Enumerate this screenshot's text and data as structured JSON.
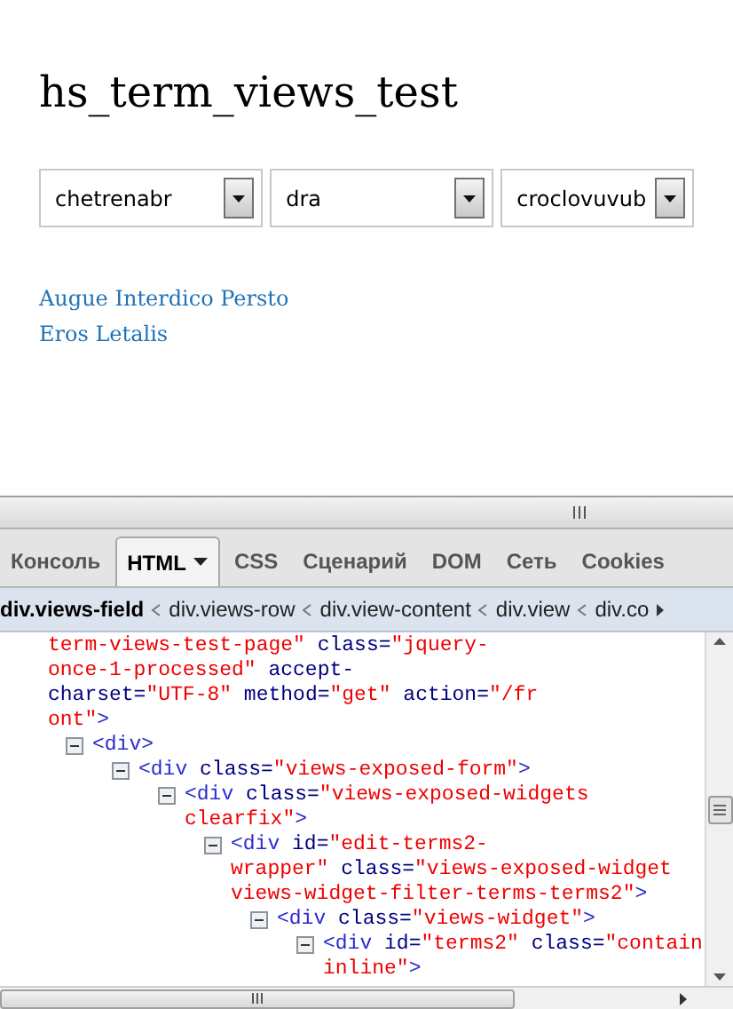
{
  "page": {
    "title": "hs_term_views_test"
  },
  "filters": [
    {
      "value": "chetrenabr"
    },
    {
      "value": "dra"
    },
    {
      "value": "croclovuvub"
    }
  ],
  "links": [
    "Augue Interdico Persto",
    "Eros Letalis"
  ],
  "devtools": {
    "tabs": [
      {
        "label": "Консоль",
        "selected": false,
        "menu": false
      },
      {
        "label": "HTML",
        "selected": true,
        "menu": true
      },
      {
        "label": "CSS",
        "selected": false,
        "menu": false
      },
      {
        "label": "Сценарий",
        "selected": false,
        "menu": false
      },
      {
        "label": "DOM",
        "selected": false,
        "menu": false
      },
      {
        "label": "Сеть",
        "selected": false,
        "menu": false
      },
      {
        "label": "Cookies",
        "selected": false,
        "menu": false
      }
    ],
    "breadcrumb": [
      {
        "label": "div.views-field",
        "selected": true
      },
      {
        "label": "div.views-row",
        "selected": false
      },
      {
        "label": "div.view-content",
        "selected": false
      },
      {
        "label": "div.view",
        "selected": false
      },
      {
        "label": "div.co",
        "selected": false
      }
    ],
    "nodes": [
      {
        "lines": [
          [
            {
              "kind": "value",
              "text": "term-views-test-page\""
            },
            {
              "kind": "attr",
              "text": " class="
            },
            {
              "kind": "value",
              "text": "\"jquery-"
            }
          ],
          [
            {
              "kind": "value",
              "text": "once-1-processed\""
            },
            {
              "kind": "attr",
              "text": " accept-"
            }
          ],
          [
            {
              "kind": "attr",
              "text": "charset="
            },
            {
              "kind": "value",
              "text": "\"UTF-8\""
            },
            {
              "kind": "attr",
              "text": " method="
            },
            {
              "kind": "value",
              "text": "\"get\""
            },
            {
              "kind": "attr",
              "text": " action="
            },
            {
              "kind": "value",
              "text": "\"/fr"
            }
          ],
          [
            {
              "kind": "value",
              "text": "ont\""
            },
            {
              "kind": "tag",
              "text": ">"
            }
          ]
        ],
        "children": [
          {
            "expanded": true,
            "lines": [
              [
                {
                  "kind": "tag",
                  "text": "<div>"
                }
              ]
            ],
            "children": [
              {
                "expanded": true,
                "lines": [
                  [
                    {
                      "kind": "tag",
                      "text": "<div"
                    },
                    {
                      "kind": "attr",
                      "text": " class="
                    },
                    {
                      "kind": "value",
                      "text": "\"views-exposed-form\""
                    },
                    {
                      "kind": "tag",
                      "text": ">"
                    }
                  ]
                ],
                "children": [
                  {
                    "expanded": true,
                    "lines": [
                      [
                        {
                          "kind": "tag",
                          "text": "<div"
                        },
                        {
                          "kind": "attr",
                          "text": " class="
                        },
                        {
                          "kind": "value",
                          "text": "\"views-exposed-widgets"
                        }
                      ],
                      [
                        {
                          "kind": "value",
                          "text": "clearfix\""
                        },
                        {
                          "kind": "tag",
                          "text": ">"
                        }
                      ]
                    ],
                    "children": [
                      {
                        "expanded": true,
                        "lines": [
                          [
                            {
                              "kind": "tag",
                              "text": "<div"
                            },
                            {
                              "kind": "attr",
                              "text": " id="
                            },
                            {
                              "kind": "value",
                              "text": "\"edit-terms2-"
                            }
                          ],
                          [
                            {
                              "kind": "value",
                              "text": "wrapper\""
                            },
                            {
                              "kind": "attr",
                              "text": " class="
                            },
                            {
                              "kind": "value",
                              "text": "\"views-exposed-widget"
                            }
                          ],
                          [
                            {
                              "kind": "value",
                              "text": "views-widget-filter-terms-terms2\""
                            },
                            {
                              "kind": "tag",
                              "text": ">"
                            }
                          ]
                        ],
                        "children": [
                          {
                            "expanded": true,
                            "lines": [
                              [
                                {
                                  "kind": "tag",
                                  "text": "<div"
                                },
                                {
                                  "kind": "attr",
                                  "text": " class="
                                },
                                {
                                  "kind": "value",
                                  "text": "\"views-widget\""
                                },
                                {
                                  "kind": "tag",
                                  "text": ">"
                                }
                              ]
                            ],
                            "children": [
                              {
                                "expanded": true,
                                "lines": [
                                  [
                                    {
                                      "kind": "tag",
                                      "text": "<div"
                                    },
                                    {
                                      "kind": "attr",
                                      "text": " id="
                                    },
                                    {
                                      "kind": "value",
                                      "text": "\"terms2\""
                                    },
                                    {
                                      "kind": "attr",
                                      "text": " class="
                                    },
                                    {
                                      "kind": "value",
                                      "text": "\"contain"
                                    }
                                  ],
                                  [
                                    {
                                      "kind": "value",
                                      "text": "inline\""
                                    },
                                    {
                                      "kind": "tag",
                                      "text": ">"
                                    }
                                  ]
                                ]
                              }
                            ]
                          }
                        ]
                      }
                    ]
                  }
                ]
              }
            ]
          }
        ]
      }
    ]
  }
}
